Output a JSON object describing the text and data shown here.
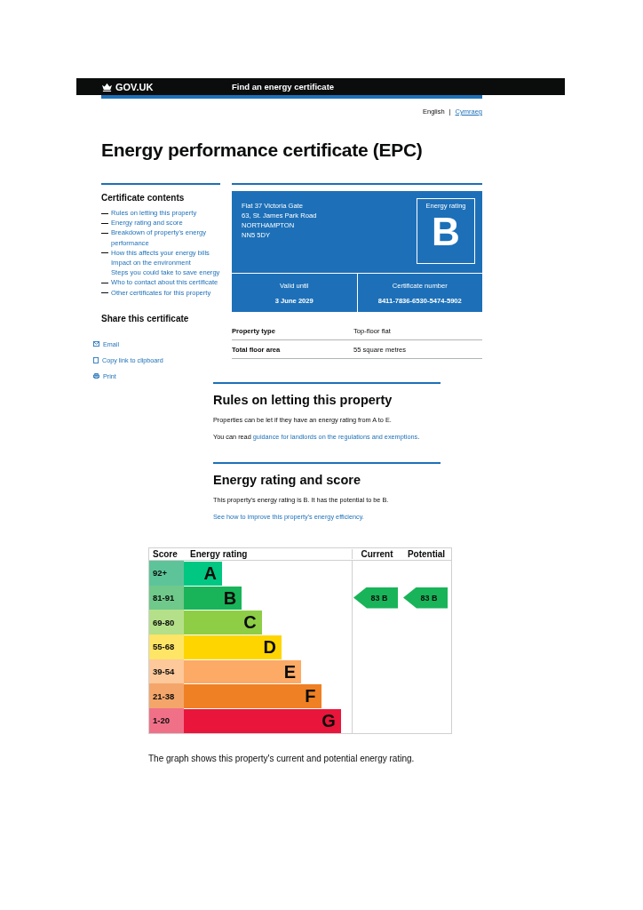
{
  "header": {
    "logo": "GOV.UK",
    "service": "Find an energy certificate"
  },
  "language_separator": "|",
  "languages": [
    {
      "label": "English",
      "selected": true
    },
    {
      "label": "Cymraeg",
      "selected": false
    }
  ],
  "title": "Energy performance certificate (EPC)",
  "contents": {
    "heading": "Certificate contents",
    "items": [
      {
        "label": "Rules on letting this property",
        "dash": true
      },
      {
        "label": "Energy rating and score",
        "dash": true
      },
      {
        "label": "Breakdown of property's energy performance",
        "dash": true
      },
      {
        "label": "How this affects your energy bills",
        "dash": true
      },
      {
        "label": "Impact on the environment",
        "dash": false
      },
      {
        "label": "Steps you could take to save energy",
        "dash": false
      },
      {
        "label": "Who to contact about this certificate",
        "dash": true
      },
      {
        "label": "Other certificates for this property",
        "dash": true
      }
    ]
  },
  "share": {
    "heading": "Share this certificate",
    "links": [
      {
        "kind": "email",
        "label": "Email"
      },
      {
        "kind": "copy",
        "label": "Copy link to clipboard"
      },
      {
        "kind": "print",
        "label": "Print"
      }
    ]
  },
  "certificate": {
    "address": [
      "Flat 37 Victoria Gate",
      "63, St. James Park Road",
      "NORTHAMPTON",
      "NN5 5DY"
    ],
    "rating_label": "Energy rating",
    "rating": "B",
    "valid_label": "Valid until",
    "valid": "3 June 2029",
    "number_label": "Certificate number",
    "number": "8411-7836-6530-5474-5902"
  },
  "summary": [
    {
      "label": "Property type",
      "value": "Top-floor flat"
    },
    {
      "label": "Total floor area",
      "value": "55 square metres"
    }
  ],
  "rules": {
    "heading": "Rules on letting this property",
    "text": "Properties can be let if they have an energy rating from A to E.",
    "link_before": "You can read ",
    "link": "guidance for landlords on the regulations and exemptions",
    "link_after": "."
  },
  "rating_section": {
    "heading": "Energy rating and score",
    "text": "This property's energy rating is B. It has the potential to be B.",
    "link": "See how to improve this property's energy efficiency."
  },
  "epc": {
    "headers": [
      "Score",
      "Energy rating",
      "Current",
      "Potential"
    ],
    "current_label": "83 B",
    "potential_label": "83 B",
    "bands": [
      {
        "score": {
          "text": "92+",
          "color": "#5dc49a"
        },
        "letter": "A",
        "color": "#00c781",
        "current": false,
        "potential": false
      },
      {
        "score": {
          "text": "81-91",
          "color": "#6fc98a"
        },
        "letter": "B",
        "color": "#19b459",
        "current": true,
        "potential": true
      },
      {
        "score": {
          "text": "69-80",
          "color": "#b5e08a"
        },
        "letter": "C",
        "color": "#8dce46",
        "current": false,
        "potential": false
      },
      {
        "score": {
          "text": "55-68",
          "color": "#ffe566"
        },
        "letter": "D",
        "color": "#ffd500",
        "current": false,
        "potential": false
      },
      {
        "score": {
          "text": "39-54",
          "color": "#fdc89a"
        },
        "letter": "E",
        "color": "#fcaa65",
        "current": false,
        "potential": false
      },
      {
        "score": {
          "text": "21-38",
          "color": "#f4a66a"
        },
        "letter": "F",
        "color": "#ef8023",
        "current": false,
        "potential": false
      },
      {
        "score": {
          "text": "1-20",
          "color": "#f07088"
        },
        "letter": "G",
        "color": "#e9153b",
        "current": false,
        "potential": false
      }
    ]
  },
  "caption": "The graph shows this property's current and potential energy rating."
}
